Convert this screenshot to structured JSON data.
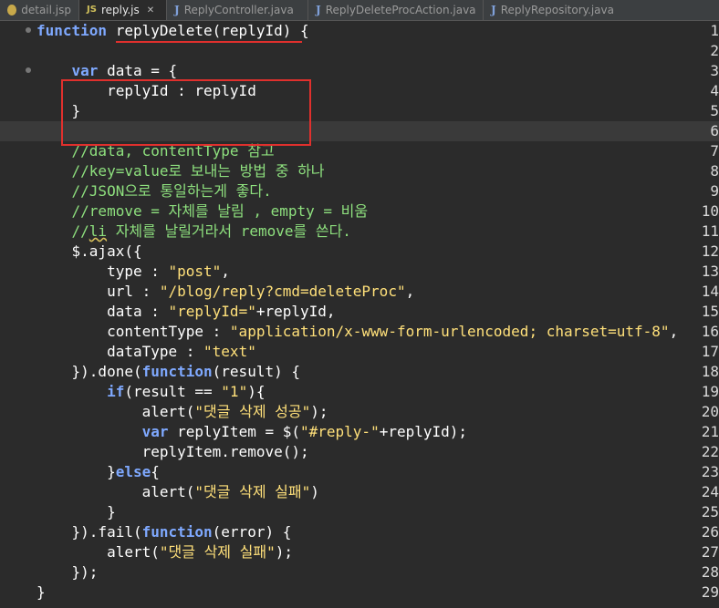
{
  "tabs": [
    {
      "label": "detail.jsp",
      "icon": "jsp-file-icon",
      "active": false
    },
    {
      "label": "reply.js",
      "icon": "js-file-icon",
      "active": true
    },
    {
      "label": "ReplyController.java",
      "icon": "java-file-icon",
      "active": false
    },
    {
      "label": "ReplyDeleteProcAction.java",
      "icon": "java-file-icon",
      "active": false
    },
    {
      "label": "ReplyRepository.java",
      "icon": "java-file-icon",
      "active": false
    }
  ],
  "js_tab_badge": "JS",
  "java_tab_badge": "J",
  "close_glyph": "✕",
  "annotation_color": "#e0302d",
  "current_line": 6,
  "line_numbers": [
    "1",
    "2",
    "3",
    "4",
    "5",
    "6",
    "7",
    "8",
    "9",
    "10",
    "11",
    "12",
    "13",
    "14",
    "15",
    "16",
    "17",
    "18",
    "19",
    "20",
    "21",
    "22",
    "23",
    "24",
    "25",
    "26",
    "27",
    "28",
    "29"
  ],
  "code": {
    "l1": {
      "kw": "function",
      "rest": " replyDelete(replyId) {"
    },
    "l3": {
      "indent": "    ",
      "kw": "var",
      "rest": " data = {"
    },
    "l4": "        replyId : replyId",
    "l5": "    }",
    "l7": "    //data, contentType 참고",
    "l8": "    //key=value로 보내는 방법 중 하나",
    "l9": "    //JSON으로 통일하는게 좋다.",
    "l10": "    //remove = 자체를 날림 , empty = 비움",
    "l11_a": "    //",
    "l11_b": "li",
    "l11_c": " 자체를 날릴거라서 remove를 쓴다.",
    "l12": "    $.ajax({",
    "l13_a": "        type : ",
    "l13_s": "\"post\"",
    "l13_c": ",",
    "l14_a": "        url : ",
    "l14_s": "\"/blog/reply?cmd=deleteProc\"",
    "l14_c": ",",
    "l15_a": "        data : ",
    "l15_s": "\"replyId=\"",
    "l15_c": "+replyId,",
    "l16_a": "        contentType : ",
    "l16_s": "\"application/x-www-form-urlencoded; charset=utf-8\"",
    "l16_c": ",",
    "l17_a": "        dataType : ",
    "l17_s": "\"text\"",
    "l18_a": "    }).done(",
    "l18_kw": "function",
    "l18_c": "(result) {",
    "l19_a": "        ",
    "l19_kw": "if",
    "l19_b": "(result == ",
    "l19_s": "\"1\"",
    "l19_c": "){",
    "l20_a": "            alert(",
    "l20_s": "\"댓글 삭제 성공\"",
    "l20_c": ");",
    "l21_a": "            ",
    "l21_kw": "var",
    "l21_b": " replyItem = $(",
    "l21_s": "\"#reply-\"",
    "l21_c": "+replyId);",
    "l22": "            replyItem.remove();",
    "l23_a": "        }",
    "l23_kw": "else",
    "l23_c": "{",
    "l24_a": "            alert(",
    "l24_s": "\"댓글 삭제 실패\"",
    "l24_c": ")",
    "l25": "        }",
    "l26_a": "    }).fail(",
    "l26_kw": "function",
    "l26_c": "(error) {",
    "l27_a": "        alert(",
    "l27_s": "\"댓글 삭제 실패\"",
    "l27_c": ");",
    "l28": "    });",
    "l29": "}"
  }
}
